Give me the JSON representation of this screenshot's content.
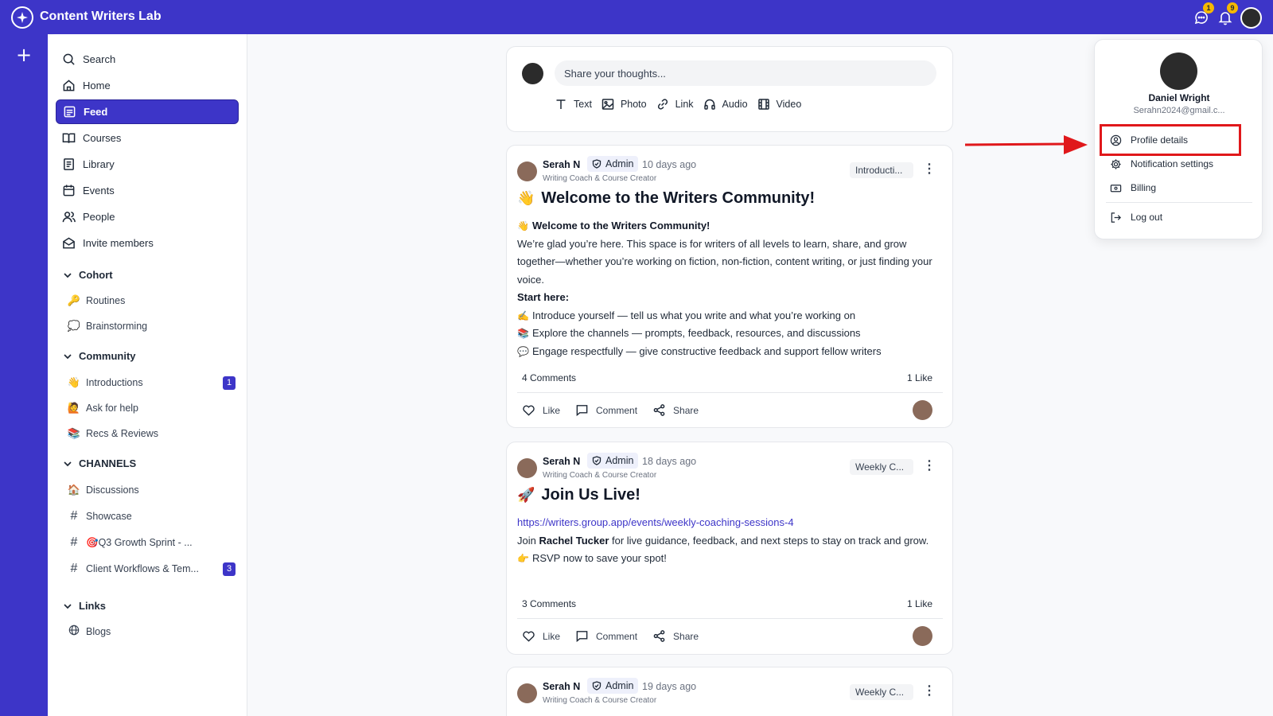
{
  "app": {
    "title": "Content Writers Lab"
  },
  "topbar": {
    "messages_badge": "1",
    "notifications_badge": "9"
  },
  "sidebar": {
    "nav": [
      {
        "label": "Search",
        "icon": "search-icon"
      },
      {
        "label": "Home",
        "icon": "home-icon"
      },
      {
        "label": "Feed",
        "icon": "feed-icon",
        "active": true
      },
      {
        "label": "Courses",
        "icon": "book-icon"
      },
      {
        "label": "Library",
        "icon": "library-icon"
      },
      {
        "label": "Events",
        "icon": "calendar-icon"
      },
      {
        "label": "People",
        "icon": "people-icon"
      },
      {
        "label": "Invite members",
        "icon": "envelope-icon"
      }
    ],
    "cohort": {
      "title": "Cohort",
      "items": [
        {
          "label": "Routines",
          "emoji": "🔑"
        },
        {
          "label": "Brainstorming",
          "emoji": "💭"
        }
      ]
    },
    "community": {
      "title": "Community",
      "items": [
        {
          "label": "Introductions",
          "emoji": "👋",
          "badge": "1"
        },
        {
          "label": "Ask for help",
          "emoji": "🙋"
        },
        {
          "label": "Recs & Reviews",
          "emoji": "📚"
        }
      ]
    },
    "channels": {
      "title": "CHANNELS",
      "items": [
        {
          "label": "Discussions",
          "emoji": "🏠"
        },
        {
          "label": "Showcase",
          "hash": "#"
        },
        {
          "label": "🎯Q3 Growth Sprint - ...",
          "hash": "#"
        },
        {
          "label": "Client Workflows & Tem...",
          "hash": "#",
          "badge": "3"
        }
      ]
    },
    "links": {
      "title": "Links",
      "items": [
        {
          "label": "Blogs",
          "icon": "globe-icon"
        }
      ]
    }
  },
  "composer": {
    "placeholder": "Share your thoughts...",
    "types": [
      "Text",
      "Photo",
      "Link",
      "Audio",
      "Video"
    ]
  },
  "posts": [
    {
      "author": "Serah N",
      "badge": "Admin",
      "time": "10 days ago",
      "role": "Writing Coach & Course Creator",
      "tag": "Introducti...",
      "title_emoji": "👋",
      "title": "Welcome to the Writers Community!",
      "intro_emoji": "👋",
      "intro": "Welcome to the Writers Community!",
      "para": "We’re glad you’re here. This space is for writers of all levels to learn, share, and grow together—whether you’re working on fiction, non-fiction, content writing, or just finding your voice.",
      "start_label": "Start here:",
      "bullets": [
        {
          "emoji": "✍️",
          "text": "Introduce yourself — tell us what you write and what you’re working on"
        },
        {
          "emoji": "📚",
          "text": "Explore the channels — prompts, feedback, resources, and discussions"
        },
        {
          "emoji": "💬",
          "text": "Engage respectfully — give constructive feedback and support fellow writers"
        }
      ],
      "comments": "4 Comments",
      "likes": "1 Like"
    },
    {
      "author": "Serah N",
      "badge": "Admin",
      "time": "18 days ago",
      "role": "Writing Coach & Course Creator",
      "tag": "Weekly C...",
      "title_emoji": "🚀",
      "title": "Join Us Live!",
      "link": "https://writers.group.app/events/weekly-coaching-sessions-4",
      "join_pre": "Join ",
      "join_name": "Rachel Tucker",
      "join_post": " for live guidance, feedback, and next steps to stay on track and grow.",
      "rsvp_emoji": "👉",
      "rsvp": "RSVP now to save your spot!",
      "comments": "3 Comments",
      "likes": "1 Like"
    },
    {
      "author": "Serah N",
      "badge": "Admin",
      "time": "19 days ago",
      "role": "Writing Coach & Course Creator",
      "tag": "Weekly C..."
    }
  ],
  "actions": {
    "like": "Like",
    "comment": "Comment",
    "share": "Share"
  },
  "profile_menu": {
    "name": "Daniel Wright",
    "email": "Serahn2024@gmail.c...",
    "items": [
      "Profile details",
      "Notification settings",
      "Billing"
    ],
    "logout": "Log out"
  },
  "colors": {
    "brand": "#3d35c8",
    "highlight": "#e0181b",
    "badge": "#f5b800"
  }
}
